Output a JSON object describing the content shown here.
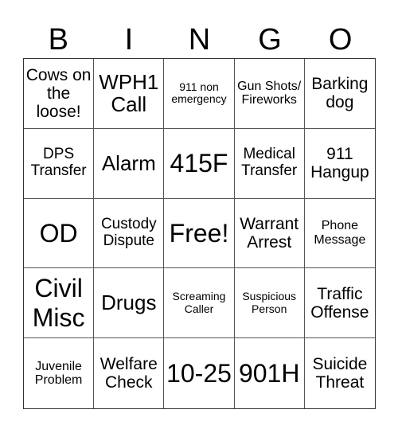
{
  "header": {
    "letters": [
      "B",
      "I",
      "N",
      "G",
      "O"
    ]
  },
  "board": {
    "rows": [
      [
        "Cows on the loose!",
        "WPH1 Call",
        "911 non emergency",
        "Gun Shots/ Fireworks",
        "Barking dog"
      ],
      [
        "DPS Transfer",
        "Alarm",
        "415F",
        "Medical Transfer",
        "911 Hangup"
      ],
      [
        "OD",
        "Custody Dispute",
        "Free!",
        "Warrant Arrest",
        "Phone Message"
      ],
      [
        "Civil Misc",
        "Drugs",
        "Screaming Caller",
        "Suspicious Person",
        "Traffic Offense"
      ],
      [
        "Juvenile Problem",
        "Welfare Check",
        "10-25",
        "901H",
        "Suicide Threat"
      ]
    ]
  }
}
